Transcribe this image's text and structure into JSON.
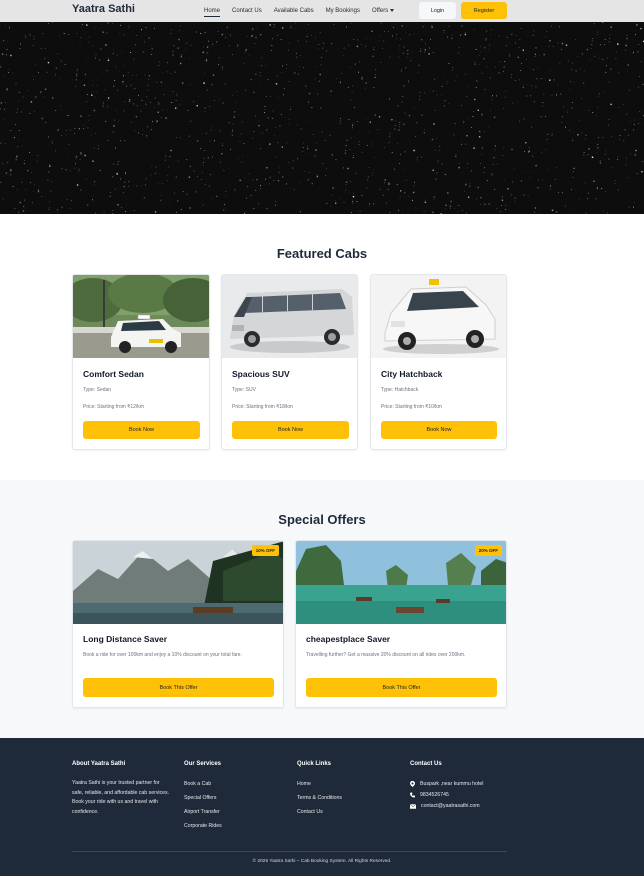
{
  "nav": {
    "brand": "Yaatra Sathi",
    "links": [
      "Home",
      "Contact Us",
      "Available Cabs",
      "My Bookings",
      "Offers"
    ],
    "login": "Login",
    "register": "Register"
  },
  "featured": {
    "title": "Featured Cabs",
    "cards": [
      {
        "name": "Comfort Sedan",
        "type": "Type: Sedan",
        "price": "Price: Starting from ₹12/km",
        "button": "Book Now"
      },
      {
        "name": "Spacious SUV",
        "type": "Type: SUV",
        "price": "Price: Starting from ₹18/km",
        "button": "Book Now"
      },
      {
        "name": "City Hatchback",
        "type": "Type: Hatchback",
        "price": "Price: Starting from ₹10/km",
        "button": "Book Now"
      }
    ]
  },
  "offers": {
    "title": "Special Offers",
    "cards": [
      {
        "badge": "10% OFF",
        "name": "Long Distance Saver",
        "desc": "Book a ride for over 100km and enjoy a 10% discount on your total fare.",
        "button": "Book This Offer"
      },
      {
        "badge": "20% OFF",
        "name": "cheapestplace Saver",
        "desc": "Travelling further? Get a massive 20% discount on all rides over 200km.",
        "button": "Book This Offer"
      }
    ]
  },
  "footer": {
    "about_title": "About Yaatra Sathi",
    "about_text": "Yaatra Sathi is your trusted partner for safe, reliable, and affordable cab services. Book your ride with us and travel with confidence.",
    "services_title": "Our Services",
    "services": [
      "Book a Cab",
      "Special Offers",
      "Airport Transfer",
      "Corporate Rides"
    ],
    "links_title": "Quick Links",
    "links": [
      "Home",
      "Terms & Conditions",
      "Contact Us"
    ],
    "contact_title": "Contact Us",
    "address": "Buspark ,near kummu hotel",
    "phone": "9834526745",
    "email": "contact@yaatrasathi.com",
    "copyright": "© 2025 Yaatra Sathi – Cab Booking System. All Rights Reserved."
  },
  "colors": {
    "accent": "#ffc107",
    "dark": "#1e2a3a"
  }
}
